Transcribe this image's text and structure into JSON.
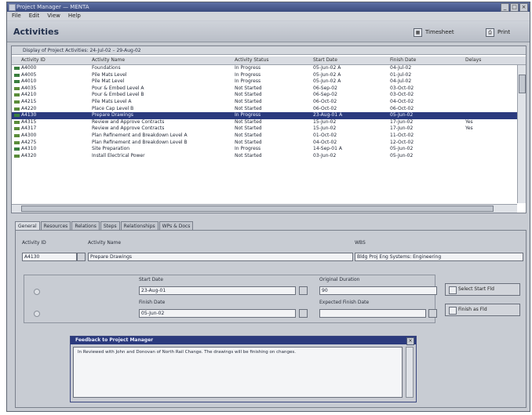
{
  "window": {
    "title": "Project Manager — MENTA"
  },
  "menu": [
    "File",
    "Edit",
    "View",
    "Help"
  ],
  "header": {
    "title": "Activities",
    "buttons": [
      {
        "label": "Timesheet",
        "icon": "calendar-icon"
      },
      {
        "label": "Print",
        "icon": "printer-icon"
      }
    ]
  },
  "grid": {
    "section_label": "Display of Project Activities: 24-Jul-02 – 29-Aug-02",
    "columns": [
      "Activity ID",
      "Activity Name",
      "Activity Status",
      "Start Date",
      "Finish Date",
      "Delays"
    ],
    "rows": [
      [
        "A4000",
        "Foundations",
        "In Progress",
        "05-Jun-02 A",
        "04-Jul-02",
        ""
      ],
      [
        "A4005",
        "Pile Mats Level",
        "In Progress",
        "05-Jun-02 A",
        "01-Jul-02",
        ""
      ],
      [
        "A4010",
        "Pile Mat Level",
        "In Progress",
        "05-Jun-02 A",
        "04-Jul-02",
        ""
      ],
      [
        "A4035",
        "Pour & Embed Level A",
        "Not Started",
        "06-Sep-02",
        "03-Oct-02",
        ""
      ],
      [
        "A4210",
        "Pour & Embed Level B",
        "Not Started",
        "06-Sep-02",
        "03-Oct-02",
        ""
      ],
      [
        "A4215",
        "Pile Mats Level A",
        "Not Started",
        "06-Oct-02",
        "04-Oct-02",
        ""
      ],
      [
        "A4220",
        "Place Cap Level B",
        "Not Started",
        "06-Oct-02",
        "06-Oct-02",
        ""
      ],
      [
        "A4130",
        "Prepare Drawings",
        "In Progress",
        "23-Aug-01 A",
        "05-Jun-02",
        ""
      ],
      [
        "A4315",
        "Review and Approve Contracts",
        "Not Started",
        "15-Jun-02",
        "17-Jun-02",
        "Yes"
      ],
      [
        "A4317",
        "Review and Approve Contracts",
        "Not Started",
        "15-Jun-02",
        "17-Jun-02",
        "Yes"
      ],
      [
        "A4300",
        "Plan Refinement and Breakdown Level A",
        "Not Started",
        "01-Oct-02",
        "11-Oct-02",
        ""
      ],
      [
        "A4275",
        "Plan Refinement and Breakdown Level B",
        "Not Started",
        "04-Oct-02",
        "12-Oct-02",
        ""
      ],
      [
        "A4310",
        "Site Preparation",
        "In Progress",
        "14-Sep-01 A",
        "05-Jun-02",
        ""
      ],
      [
        "A4320",
        "Install Electrical Power",
        "Not Started",
        "03-Jun-02",
        "05-Jun-02",
        ""
      ]
    ],
    "selected_index": 7
  },
  "tabs": [
    "General",
    "Resources",
    "Relations",
    "Steps",
    "Relationships",
    "WPs & Docs"
  ],
  "general": {
    "activity_id_label": "Activity ID",
    "activity_id": "A4130",
    "activity_name_label": "Activity Name",
    "activity_name": "Prepare Drawings",
    "wbs_label": "WBS",
    "wbs": "Bldg Proj Eng Systems: Engineering",
    "start_date_label": "Start Date",
    "start_date": "23-Aug-01",
    "finish_date_label": "Finish Date",
    "finish_date": "05-Jun-02",
    "original_duration_label": "Original Duration",
    "original_duration": "90",
    "expected_finish_label": "Expected Finish Date",
    "expected_finish": "",
    "btn_select_start": "Select Start Fld",
    "btn_finish_fld": "Finish as Fld"
  },
  "feedback": {
    "title": "Feedback to Project Manager",
    "text": "In Reviewed with John and Donovan of North Rail Change. The drawings will be finishing on changes."
  }
}
